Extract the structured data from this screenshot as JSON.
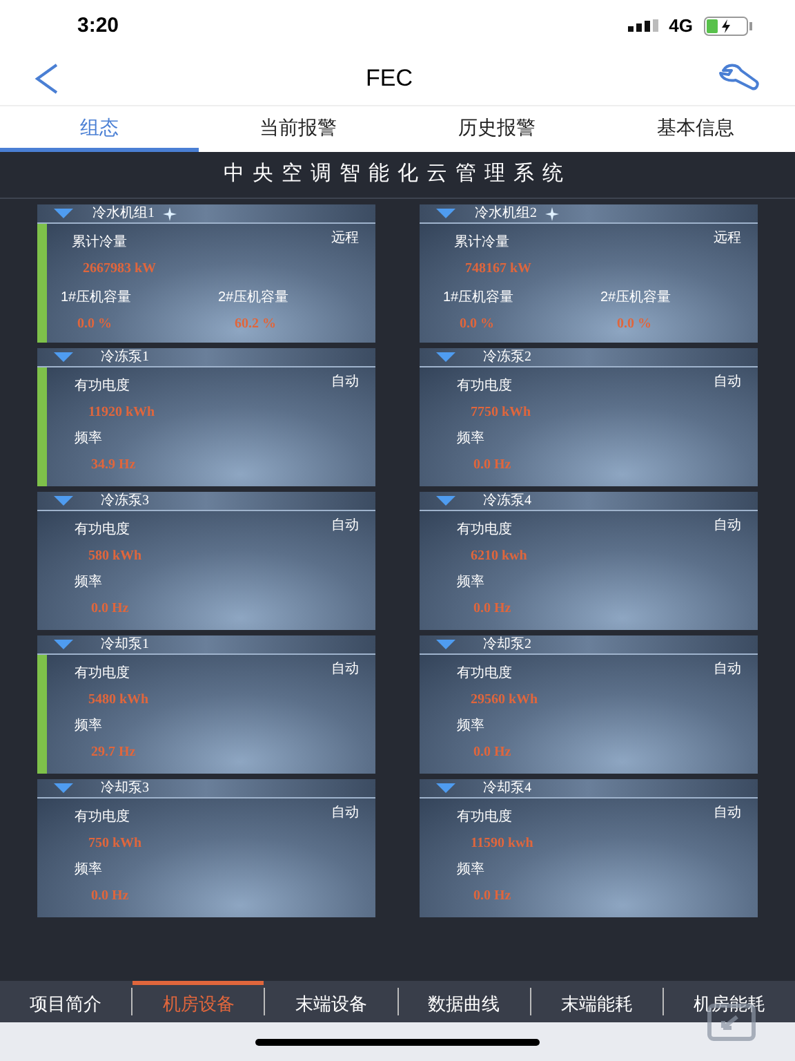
{
  "status_bar": {
    "time": "3:20",
    "network": "4G"
  },
  "nav": {
    "title": "FEC"
  },
  "tabs": [
    {
      "label": "组态",
      "selected": true
    },
    {
      "label": "当前报警",
      "selected": false
    },
    {
      "label": "历史报警",
      "selected": false
    },
    {
      "label": "基本信息",
      "selected": false
    }
  ],
  "panel": {
    "title": "中央空调智能化云管理系统",
    "cards": [
      {
        "kind": "chiller",
        "title": "冷水机组1",
        "mode": "远程",
        "running": true,
        "fields": [
          {
            "label": "累计冷量",
            "value": "2667983 kW"
          },
          {
            "label": "1#压机容量",
            "value": "0.0 %"
          },
          {
            "label": "2#压机容量",
            "value": "60.2 %"
          }
        ]
      },
      {
        "kind": "chiller",
        "title": "冷水机组2",
        "mode": "远程",
        "running": false,
        "fields": [
          {
            "label": "累计冷量",
            "value": "748167 kW"
          },
          {
            "label": "1#压机容量",
            "value": "0.0 %"
          },
          {
            "label": "2#压机容量",
            "value": "0.0 %"
          }
        ]
      },
      {
        "kind": "pump",
        "title": "冷冻泵1",
        "mode": "自动",
        "running": true,
        "fields": [
          {
            "label": "有功电度",
            "value": "11920 kWh"
          },
          {
            "label": "频率",
            "value": "34.9 Hz"
          }
        ]
      },
      {
        "kind": "pump",
        "title": "冷冻泵2",
        "mode": "自动",
        "running": false,
        "fields": [
          {
            "label": "有功电度",
            "value": "7750 kWh"
          },
          {
            "label": "频率",
            "value": "0.0 Hz"
          }
        ]
      },
      {
        "kind": "pump",
        "title": "冷冻泵3",
        "mode": "自动",
        "running": false,
        "fields": [
          {
            "label": "有功电度",
            "value": "580 kWh"
          },
          {
            "label": "频率",
            "value": "0.0 Hz"
          }
        ]
      },
      {
        "kind": "pump",
        "title": "冷冻泵4",
        "mode": "自动",
        "running": false,
        "fields": [
          {
            "label": "有功电度",
            "value": "6210 kwh"
          },
          {
            "label": "频率",
            "value": "0.0 Hz"
          }
        ]
      },
      {
        "kind": "pump",
        "title": "冷却泵1",
        "mode": "自动",
        "running": true,
        "fields": [
          {
            "label": "有功电度",
            "value": "5480 kWh"
          },
          {
            "label": "频率",
            "value": "29.7 Hz"
          }
        ]
      },
      {
        "kind": "pump",
        "title": "冷却泵2",
        "mode": "自动",
        "running": false,
        "fields": [
          {
            "label": "有功电度",
            "value": "29560 kWh"
          },
          {
            "label": "频率",
            "value": "0.0 Hz"
          }
        ]
      },
      {
        "kind": "pump",
        "title": "冷却泵3",
        "mode": "自动",
        "running": false,
        "fields": [
          {
            "label": "有功电度",
            "value": "750 kWh"
          },
          {
            "label": "频率",
            "value": "0.0 Hz"
          }
        ]
      },
      {
        "kind": "pump",
        "title": "冷却泵4",
        "mode": "自动",
        "running": false,
        "fields": [
          {
            "label": "有功电度",
            "value": "11590 kwh"
          },
          {
            "label": "频率",
            "value": "0.0 Hz"
          }
        ]
      }
    ]
  },
  "bottom_tabs": [
    {
      "label": "项目简介",
      "selected": false
    },
    {
      "label": "机房设备",
      "selected": true
    },
    {
      "label": "末端设备",
      "selected": false
    },
    {
      "label": "数据曲线",
      "selected": false
    },
    {
      "label": "末端能耗",
      "selected": false
    },
    {
      "label": "机房能耗",
      "selected": false
    }
  ]
}
